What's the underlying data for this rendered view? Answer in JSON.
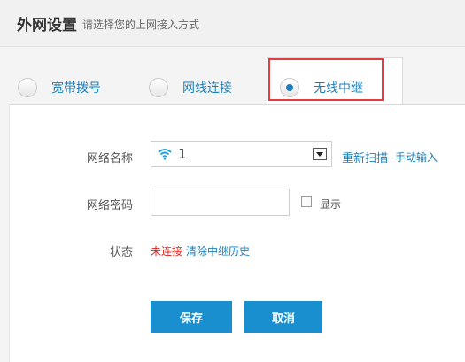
{
  "header": {
    "title": "外网设置",
    "subtitle": "请选择您的上网接入方式"
  },
  "tabs": [
    {
      "label": "宽带拨号",
      "checked": false
    },
    {
      "label": "网线连接",
      "checked": false
    },
    {
      "label": "无线中继",
      "checked": true
    }
  ],
  "form": {
    "network_name_label": "网络名称",
    "network_name_value": "1",
    "rescan_label": "重新扫描",
    "manual_input_label": "手动输入",
    "password_label": "网络密码",
    "password_value": "",
    "show_label": "显示",
    "status_label": "状态",
    "status_value": "未连接",
    "clear_history_label": "清除中继历史"
  },
  "buttons": {
    "save": "保存",
    "cancel": "取消"
  },
  "colors": {
    "accent": "#1a8fcf",
    "link": "#1c7db7",
    "status_error": "#d9231d",
    "highlight": "#e53b3b"
  },
  "icons": {
    "wifi": "wifi-icon",
    "dropdown": "chevron-down-icon"
  }
}
